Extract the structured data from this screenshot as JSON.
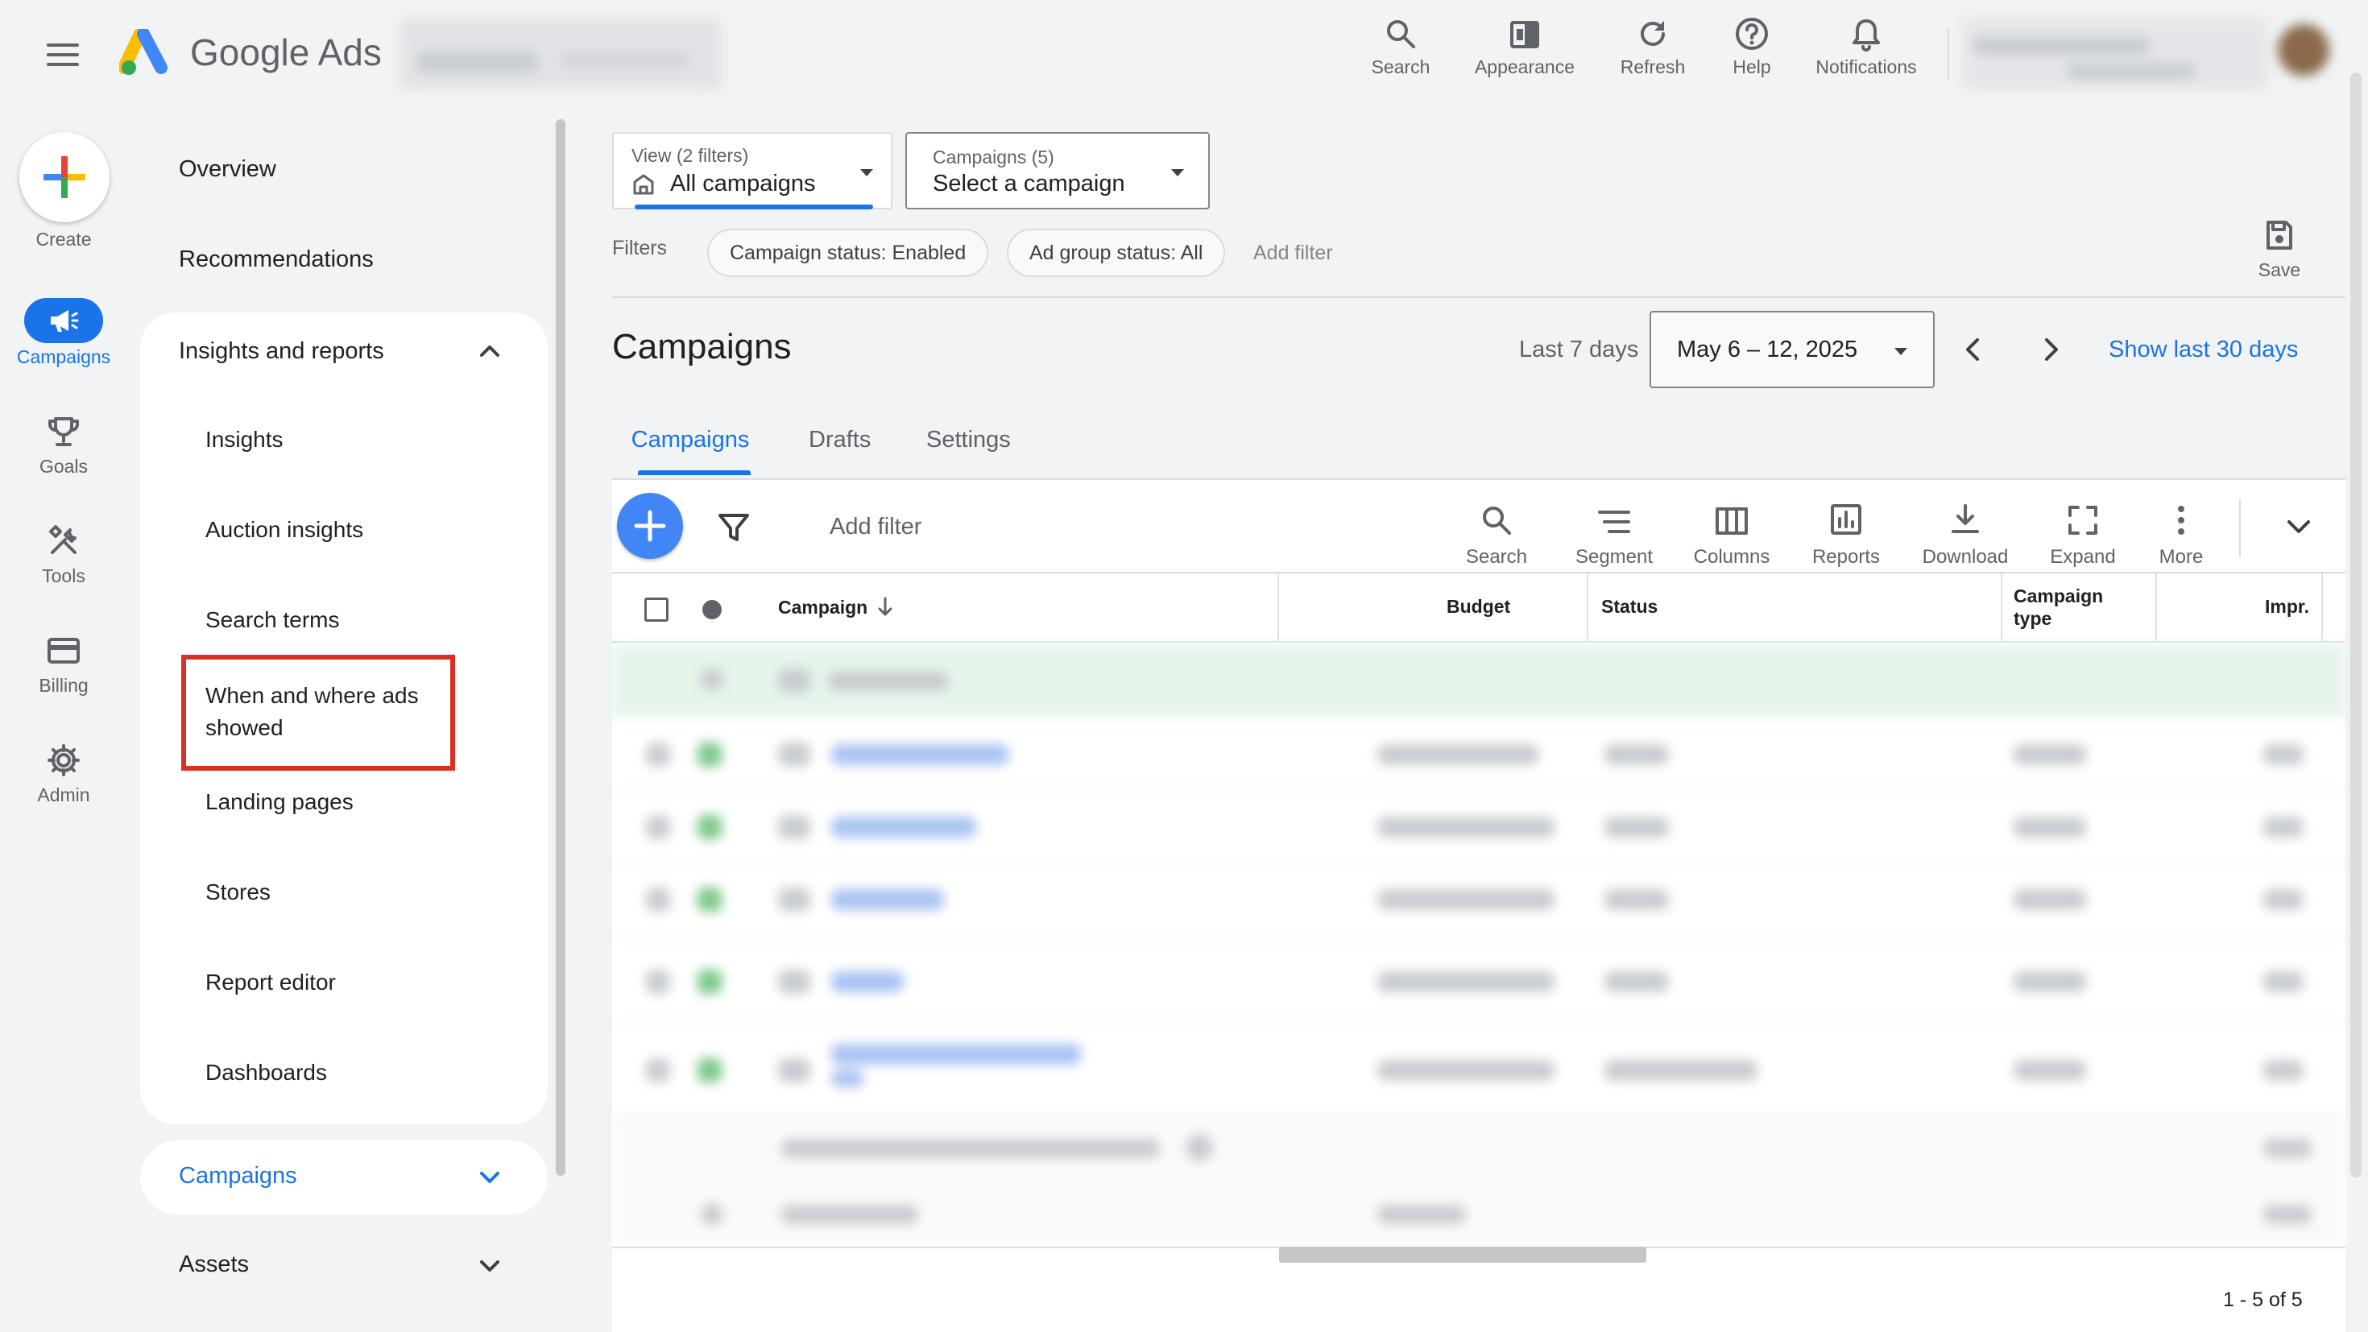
{
  "header": {
    "app_name": "Google Ads",
    "actions": [
      {
        "label": "Search"
      },
      {
        "label": "Appearance"
      },
      {
        "label": "Refresh"
      },
      {
        "label": "Help"
      },
      {
        "label": "Notifications"
      }
    ]
  },
  "rail": {
    "create_label": "Create",
    "items": [
      {
        "label": "Campaigns",
        "active": true
      },
      {
        "label": "Goals"
      },
      {
        "label": "Tools"
      },
      {
        "label": "Billing"
      },
      {
        "label": "Admin"
      }
    ]
  },
  "nav": {
    "overview": "Overview",
    "recommendations": "Recommendations",
    "insights_reports": {
      "label": "Insights and reports",
      "children": [
        {
          "label": "Insights"
        },
        {
          "label": "Auction insights"
        },
        {
          "label": "Search terms"
        },
        {
          "label": "When and where ads showed",
          "highlighted": true
        },
        {
          "label": "Landing pages"
        },
        {
          "label": "Stores"
        },
        {
          "label": "Report editor"
        },
        {
          "label": "Dashboards"
        }
      ]
    },
    "campaigns_group": "Campaigns",
    "assets_group": "Assets"
  },
  "selectors": {
    "view": {
      "caption": "View (2 filters)",
      "value": "All campaigns"
    },
    "campaigns": {
      "caption": "Campaigns (5)",
      "value": "Select a campaign"
    }
  },
  "filters": {
    "label": "Filters",
    "chips": [
      "Campaign status: Enabled",
      "Ad group status: All"
    ],
    "add_filter": "Add filter",
    "save_label": "Save"
  },
  "page": {
    "title": "Campaigns",
    "date_range_label": "Last 7 days",
    "date_range_value": "May 6 – 12, 2025",
    "show_last_30": "Show last 30 days"
  },
  "tabs": [
    {
      "label": "Campaigns",
      "active": true
    },
    {
      "label": "Drafts"
    },
    {
      "label": "Settings"
    }
  ],
  "toolbar": {
    "add_filter": "Add filter",
    "buttons": [
      {
        "label": "Search"
      },
      {
        "label": "Segment"
      },
      {
        "label": "Columns"
      },
      {
        "label": "Reports"
      },
      {
        "label": "Download"
      },
      {
        "label": "Expand"
      },
      {
        "label": "More"
      }
    ]
  },
  "table": {
    "headers": {
      "campaign": "Campaign",
      "budget": "Budget",
      "status": "Status",
      "campaign_type_1": "Campaign",
      "campaign_type_2": "type",
      "impr": "Impr."
    },
    "pagination": "1 - 5 of 5"
  },
  "colors": {
    "accent": "#1a73e8",
    "highlight_border": "#d93025",
    "active_rail_bg": "#1a73e8"
  }
}
